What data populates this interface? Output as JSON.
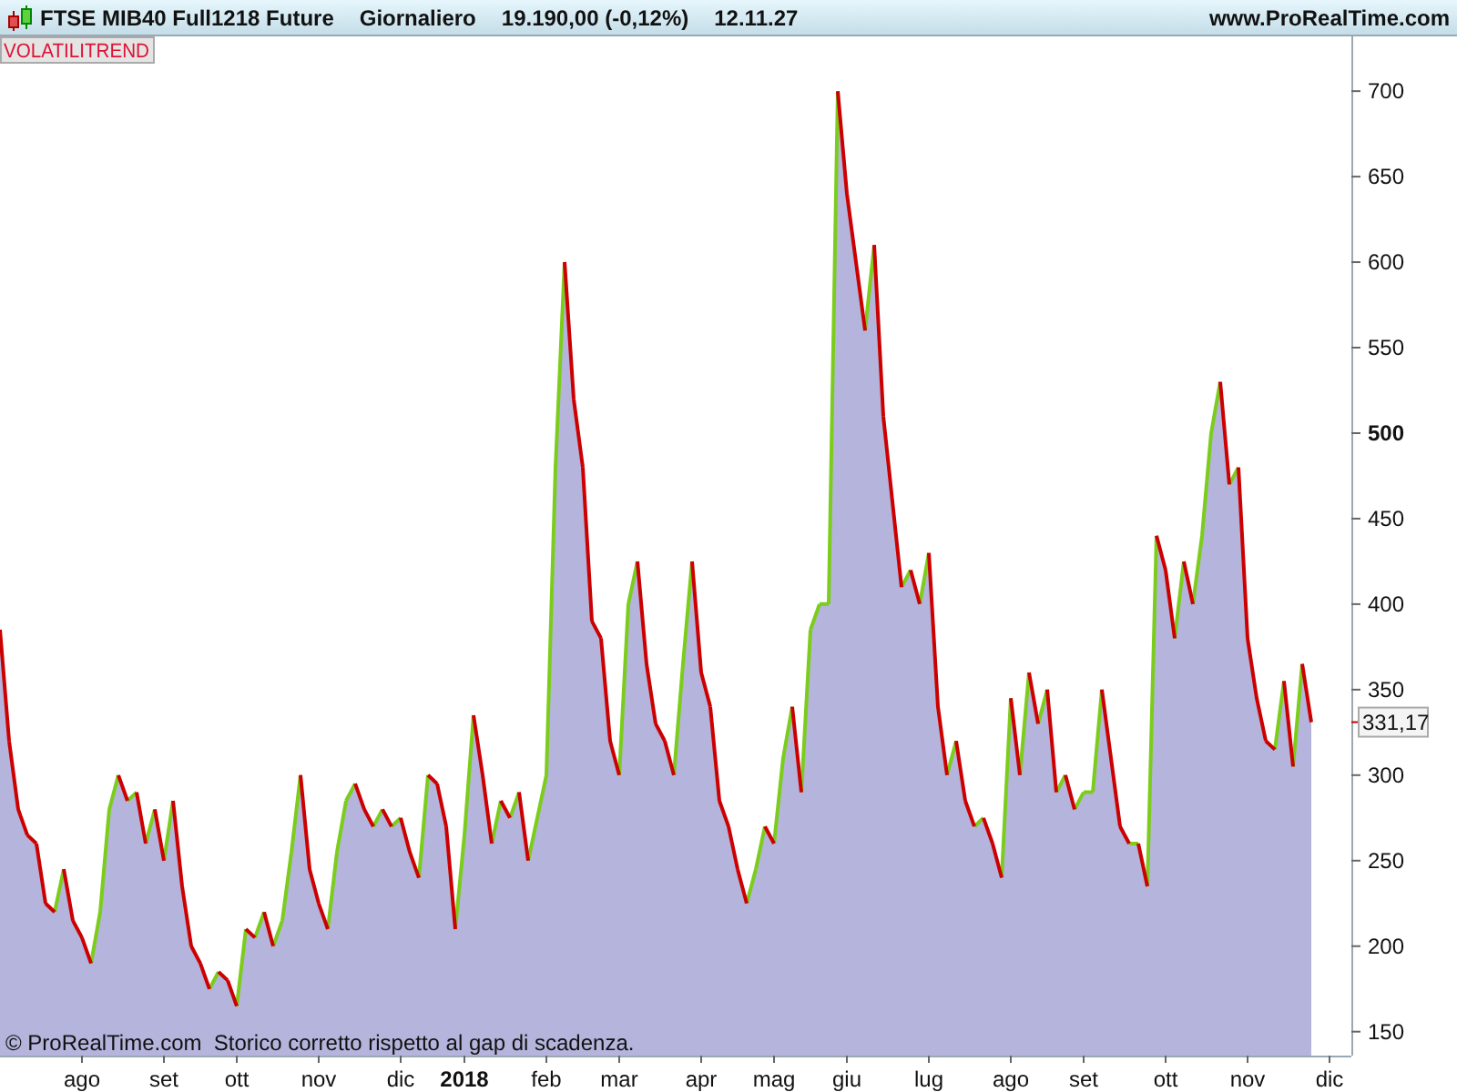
{
  "header": {
    "title": "FTSE MIB40 Full1218 Future",
    "period": "Giornaliero",
    "price": "19.190,00 (-0,12%)",
    "time": "12.11.27",
    "website": "www.ProRealTime.com"
  },
  "indicator": {
    "last_value_label": "331,17",
    "footer_note": "© ProRealTime.com  Storico corretto rispetto al gap di scadenza.",
    "chart_data": {
      "type": "area",
      "ylim": [
        136,
        732
      ],
      "yticks": [
        150,
        200,
        250,
        300,
        350,
        400,
        450,
        500,
        550,
        600,
        650,
        700
      ],
      "categories": [
        null,
        null,
        null,
        null,
        null,
        null,
        null,
        null,
        null,
        "ago",
        null,
        null,
        null,
        null,
        null,
        null,
        null,
        null,
        "set",
        null,
        null,
        null,
        null,
        null,
        null,
        null,
        "ott",
        null,
        null,
        null,
        null,
        null,
        null,
        null,
        null,
        "nov",
        null,
        null,
        null,
        null,
        null,
        null,
        null,
        null,
        "dic",
        null,
        null,
        null,
        null,
        null,
        null,
        "2018",
        null,
        null,
        null,
        null,
        null,
        null,
        null,
        null,
        "feb",
        null,
        null,
        null,
        null,
        null,
        null,
        null,
        "mar",
        null,
        null,
        null,
        null,
        null,
        null,
        null,
        null,
        "apr",
        null,
        null,
        null,
        null,
        null,
        null,
        null,
        "mag",
        null,
        null,
        null,
        null,
        null,
        null,
        null,
        "giu",
        null,
        null,
        null,
        null,
        null,
        null,
        null,
        null,
        "lug",
        null,
        null,
        null,
        null,
        null,
        null,
        null,
        null,
        "ago",
        null,
        null,
        null,
        null,
        null,
        null,
        null,
        "set",
        null,
        null,
        null,
        null,
        null,
        null,
        null,
        null,
        "ott",
        null,
        null,
        null,
        null,
        null,
        null,
        null,
        null,
        "nov",
        null,
        null,
        null,
        null,
        null,
        null,
        null,
        null,
        "dic"
      ],
      "series": [
        {
          "name": "VOLATILITREND",
          "color": "#b4b4dc",
          "values": [
            385,
            320,
            280,
            265,
            260,
            225,
            220,
            245,
            215,
            205,
            190,
            220,
            280,
            300,
            285,
            290,
            260,
            280,
            250,
            285,
            235,
            200,
            190,
            175,
            185,
            180,
            165,
            210,
            205,
            220,
            200,
            215,
            255,
            300,
            245,
            225,
            210,
            255,
            285,
            295,
            280,
            270,
            280,
            270,
            275,
            255,
            240,
            300,
            295,
            270,
            210,
            265,
            335,
            300,
            260,
            285,
            275,
            290,
            250,
            275,
            300,
            480,
            600,
            520,
            480,
            390,
            380,
            320,
            300,
            400,
            425,
            365,
            330,
            320,
            300,
            365,
            425,
            360,
            340,
            285,
            270,
            245,
            225,
            245,
            270,
            260,
            310,
            340,
            290,
            385,
            400,
            400,
            700,
            640,
            600,
            560,
            610,
            510,
            460,
            410,
            420,
            400,
            430,
            340,
            300,
            320,
            285,
            270,
            275,
            260,
            240,
            345,
            300,
            360,
            330,
            350,
            290,
            300,
            280,
            290,
            290,
            350,
            310,
            270,
            260,
            260,
            235,
            440,
            420,
            380,
            425,
            400,
            440,
            500,
            530,
            470,
            480,
            380,
            345,
            320,
            315,
            355,
            305,
            365,
            331,
            null,
            null
          ]
        }
      ]
    }
  }
}
